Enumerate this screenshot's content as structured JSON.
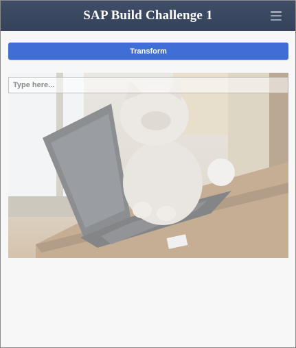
{
  "header": {
    "title": "SAP Build Challenge 1",
    "menu_icon": "hamburger-menu-icon",
    "background": "#3a4860"
  },
  "toolbar": {
    "transform_label": "Transform",
    "accent": "#3f6fd6"
  },
  "input": {
    "placeholder": "Type here...",
    "value": ""
  },
  "image": {
    "subject": "cat-on-laptop-photo",
    "overlay": "white semi-transparent"
  }
}
